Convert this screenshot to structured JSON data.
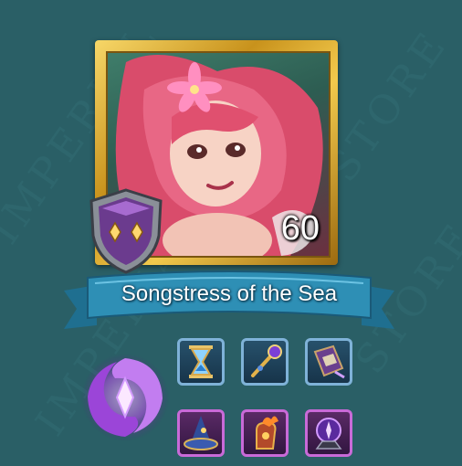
{
  "hero": {
    "name": "Songstress of the Sea",
    "level": "60"
  },
  "badge": {
    "icon": "purple-rank-shield-icon"
  },
  "faction": {
    "icon": "purple-swirl-faction-icon"
  },
  "equipment": {
    "top": [
      {
        "icon": "hourglass-icon",
        "rarity": "blue"
      },
      {
        "icon": "scepter-icon",
        "rarity": "blue"
      },
      {
        "icon": "spellbook-icon",
        "rarity": "blue"
      }
    ],
    "bottom": [
      {
        "icon": "wizard-hat-icon",
        "rarity": "purple"
      },
      {
        "icon": "flame-gauntlet-icon",
        "rarity": "purple"
      },
      {
        "icon": "crystal-orb-icon",
        "rarity": "purple"
      }
    ]
  },
  "colors": {
    "background": "#2a5f66",
    "frame_gold": "#e0b23a",
    "ribbon": "#2e8fb5",
    "epic_border": "#c96ad8",
    "rare_border": "#7fb2d8"
  }
}
